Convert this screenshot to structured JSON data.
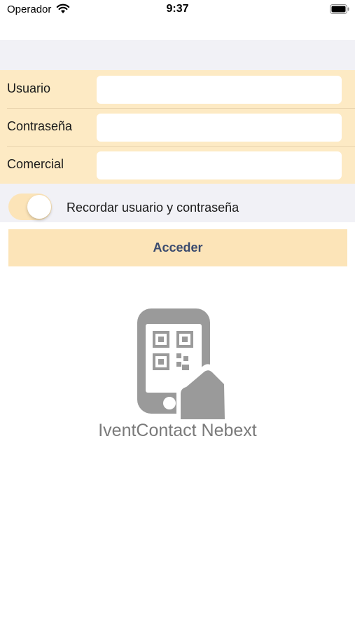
{
  "status_bar": {
    "carrier": "Operador",
    "time": "9:37",
    "wifi_icon": "wifi-icon",
    "battery_icon": "battery-icon"
  },
  "login_form": {
    "fields": [
      {
        "label": "Usuario",
        "value": "",
        "placeholder": ""
      },
      {
        "label": "Contraseña",
        "value": "",
        "placeholder": ""
      },
      {
        "label": "Comercial",
        "value": "",
        "placeholder": ""
      }
    ],
    "remember": {
      "label": "Recordar usuario y contraseña",
      "enabled": true
    },
    "submit_label": "Acceder"
  },
  "branding": {
    "logo_icon": "qr-phone-logo-icon",
    "app_name": "IventContact Nebext"
  },
  "colors": {
    "form_background": "#fdeac4",
    "button_background": "#fce4b8",
    "button_text": "#3a4a6e",
    "section_background": "#f1f1f6",
    "logo_gray": "#9a9a9a"
  }
}
